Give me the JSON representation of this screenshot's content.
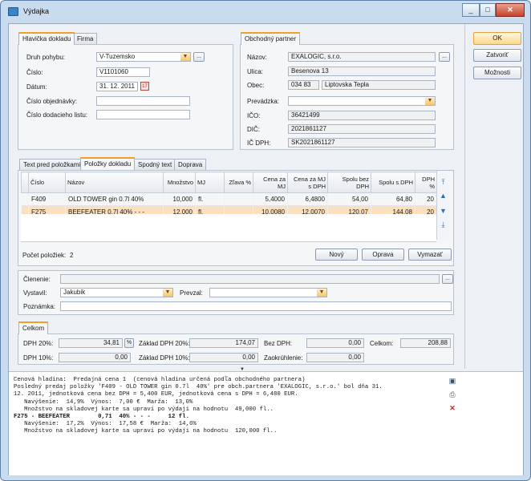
{
  "window": {
    "title": "Výdajka"
  },
  "right_buttons": {
    "ok": "OK",
    "close": "Zatvoriť",
    "options": "Možnosti"
  },
  "header_tabs": {
    "head": "Hlavička dokladu",
    "firm": "Firma"
  },
  "header": {
    "movement_label": "Druh pohybu:",
    "movement_value": "V-Tuzemsko",
    "number_label": "Číslo:",
    "number_value": "V1101060",
    "date_label": "Dátum:",
    "date_value": "31. 12. 2011",
    "order_label": "Číslo objednávky:",
    "order_value": "",
    "delivery_label": "Číslo dodacieho listu:",
    "delivery_value": ""
  },
  "partner_tab": "Obchodný partner",
  "partner": {
    "name_label": "Názov:",
    "name_value": "EXALOGIC, s.r.o.",
    "street_label": "Ulica:",
    "street_value": "Besenova 13",
    "city_label": "Obec:",
    "zip_value": "034 83",
    "city_value": "Liptovska Tepla",
    "branch_label": "Prevádzka:",
    "branch_value": "",
    "ico_label": "IČO:",
    "ico_value": "36421499",
    "dic_label": "DIČ:",
    "dic_value": "2021861127",
    "icdph_label": "IČ DPH:",
    "icdph_value": "SK2021861127"
  },
  "items_tabs": [
    "Text pred položkami",
    "Položky dokladu",
    "Spodný text",
    "Doprava"
  ],
  "items_table": {
    "columns": [
      "Číslo",
      "Názov",
      "Množstvo",
      "MJ",
      "Zľava %",
      "Cena za MJ",
      "Cena za MJ s DPH",
      "Spolu bez DPH",
      "Spolu s DPH",
      "DPH %"
    ],
    "rows": [
      [
        "F409",
        "OLD TOWER gin 0.7l 40%",
        "10,000",
        "fl.",
        "",
        "5,4000",
        "6,4800",
        "54,00",
        "64,80",
        "20"
      ],
      [
        "F275",
        "BEEFEATER 0,7l 40% - - -",
        "12,000",
        "fl.",
        "",
        "10,0080",
        "12,0070",
        "120,07",
        "144,08",
        "20"
      ]
    ]
  },
  "items_footer": {
    "count_label": "Počet položiek:",
    "count_value": "2",
    "new": "Nový",
    "edit": "Oprava",
    "delete": "Vymazať"
  },
  "classification": {
    "division_label": "Členenie:",
    "division_value": "",
    "issued_label": "Vystavil:",
    "issued_value": "Jakubik",
    "received_label": "Prevzal:",
    "received_value": "",
    "note_label": "Poznámka:",
    "note_value": ""
  },
  "totals_tab": "Celkom",
  "totals": {
    "dph20_label": "DPH 20%:",
    "dph20_value": "34,81",
    "base20_label": "Základ DPH 20%:",
    "base20_value": "174,07",
    "nodph_label": "Bez DPH:",
    "nodph_value": "0,00",
    "total_label": "Celkom:",
    "total_value": "208,88",
    "dph10_label": "DPH 10%:",
    "dph10_value": "0,00",
    "base10_label": "Základ DPH 10%:",
    "base10_value": "0,00",
    "round_label": "Zaokrúhlenie:",
    "round_value": "0,00"
  },
  "memo": {
    "line1": "Cenová hladina:  Predajná cena 1  (cenová hladina určená podľa obchodného partnera)",
    "line2": "Posledný predaj položky 'F409 - OLD TOWER gin 0.7l  40%' pre obch.partnera 'EXALOGIC, s.r.o.' bol dňa 31.",
    "line3": "12. 2011, jednotková cena bez DPH = 5,400 EUR, jednotková cena s DPH = 6,480 EUR.",
    "line4": "   Navýšenie:  14,9%  Výnos:  7,00 €  Marža:  13,0%",
    "line5": "   Množstvo na skladovej karte sa upraví po výdaji na hodnotu  49,000 fl..",
    "line6": "F275 - BEEFEATER        0,71  40% - - -     12 fl.",
    "line7": "   Navýšenie:  17,2%  Výnos:  17,58 €  Marža:  14,6%",
    "line8": "   Množstvo na skladovej karte sa upraví po výdaji na hodnotu  120,000 fl.."
  },
  "colors": {
    "accent": "#f0a02a",
    "selected_row": "#fbe0c0",
    "frame": "#c9dcef"
  }
}
